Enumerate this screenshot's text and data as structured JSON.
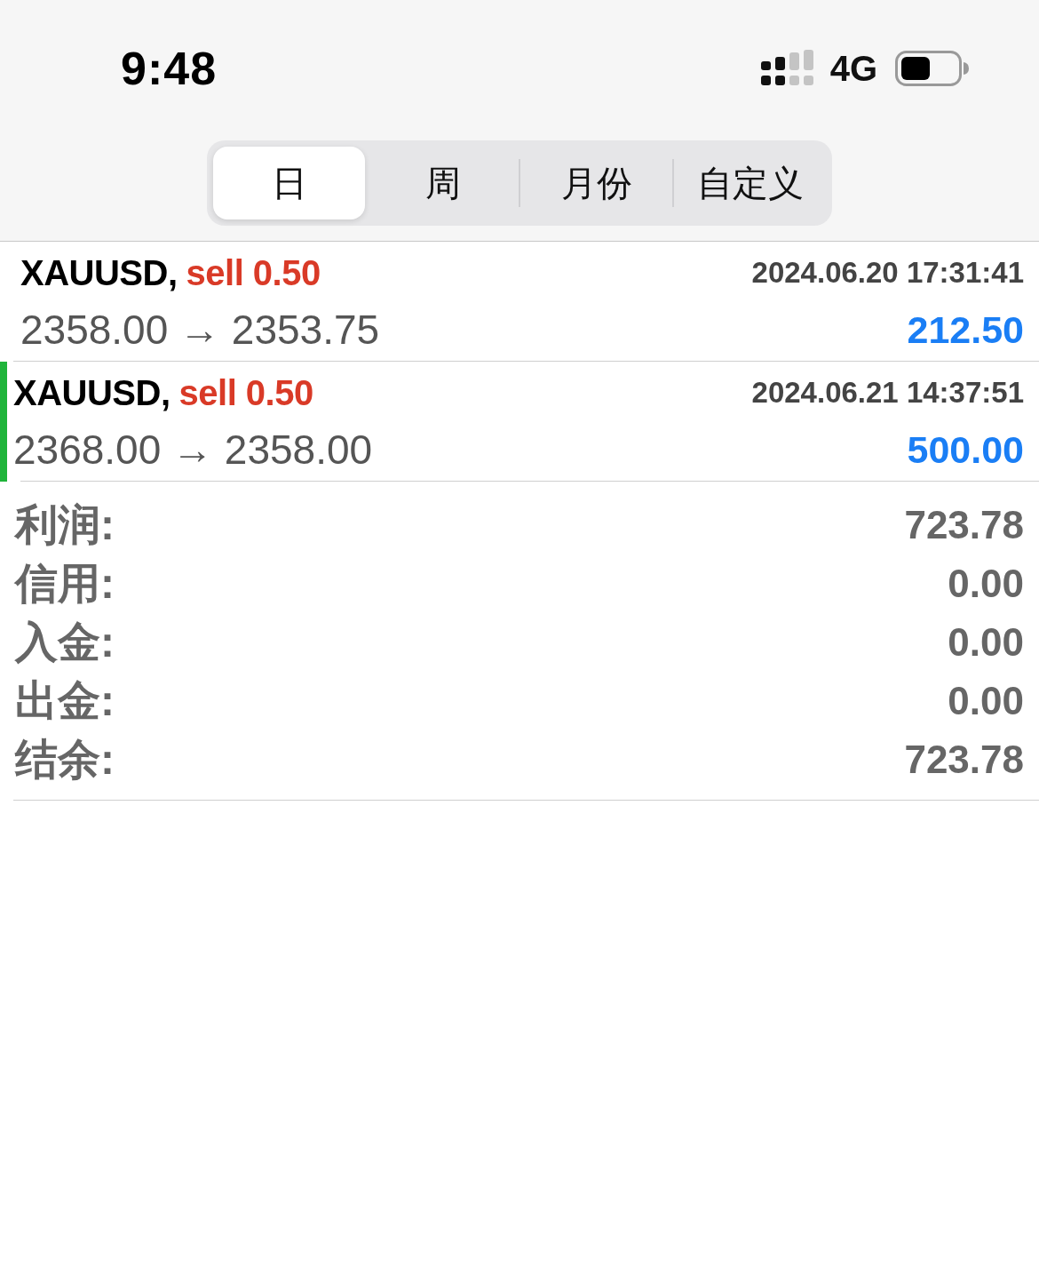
{
  "status_bar": {
    "time": "9:48",
    "network": "4G"
  },
  "tabs": [
    {
      "label": "日",
      "selected": true
    },
    {
      "label": "周",
      "selected": false
    },
    {
      "label": "月份",
      "selected": false
    },
    {
      "label": "自定义",
      "selected": false
    }
  ],
  "trades": [
    {
      "symbol": "XAUUSD,",
      "kind": "sell",
      "order": "sell 0.50",
      "time": "2024.06.20 17:31:41",
      "prices": "2358.00 → 2353.75",
      "profit": "212.50",
      "selected": false
    },
    {
      "symbol": "XAUUSD,",
      "kind": "sell",
      "order": "sell 0.50",
      "time": "2024.06.21 14:37:51",
      "prices": "2368.00 → 2358.00",
      "profit": "500.00",
      "selected": true
    }
  ],
  "summary": [
    {
      "label": "利润:",
      "value": "723.78"
    },
    {
      "label": "信用:",
      "value": "0.00"
    },
    {
      "label": "入金:",
      "value": "0.00"
    },
    {
      "label": "出金:",
      "value": "0.00"
    },
    {
      "label": "结余:",
      "value": "723.78"
    }
  ]
}
